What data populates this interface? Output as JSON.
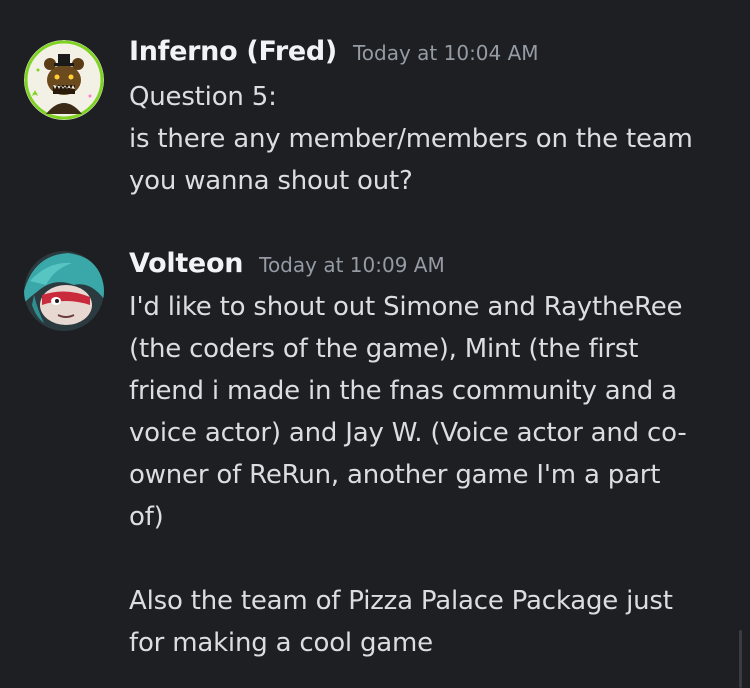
{
  "messages": [
    {
      "username": "Inferno (Fred)",
      "timestamp": "Today at 10:04 AM",
      "avatar_icon": "animatronic-bear-avatar",
      "lines": [
        "Question 5:",
        "is there any member/members on the team",
        "you wanna shout out?"
      ]
    },
    {
      "username": "Volteon",
      "timestamp": "Today at 10:09 AM",
      "avatar_icon": "teal-hair-character-avatar",
      "lines": [
        "I'd like to shout out Simone and RaytheRee",
        "(the coders of the game), Mint (the first",
        "friend i made in the fnas community and a",
        "voice actor) and Jay W. (Voice actor and co-",
        "owner of ReRun, another game I'm a part",
        "of)",
        "",
        "Also the team of Pizza Palace Package just",
        "for making a cool game"
      ]
    }
  ],
  "colors": {
    "background": "#1e1f22",
    "username": "#f2f3f5",
    "timestamp": "#949ba4",
    "text": "#dbdee1"
  }
}
